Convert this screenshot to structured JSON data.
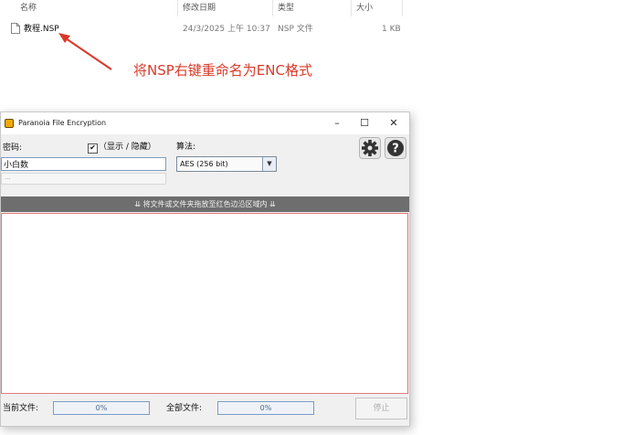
{
  "explorer": {
    "columns": {
      "name": "名称",
      "date": "修改日期",
      "type": "类型",
      "size": "大小"
    },
    "file": {
      "name": "教程.NSP",
      "date": "24/3/2025 上午 10:37",
      "type": "NSP 文件",
      "size": "1 KB"
    }
  },
  "annotation": {
    "text": "将NSP右键重命名为ENC格式",
    "color": "#d93a2a"
  },
  "app": {
    "title": "Paranoia File Encryption",
    "window_controls": {
      "minimize": "–",
      "maximize": "☐",
      "close": "✕"
    },
    "password_label": "密码:",
    "show_hide_label": "（显示 / 隐藏）",
    "show_hide_checked": "✔",
    "password_value": "小白数",
    "strength_text": "...",
    "algorithm_label": "算法:",
    "algorithm_value": "AES (256 bit)",
    "drop_banner": "⇊ 将文件或文件夹拖放至红色边沿区域内 ⇊",
    "current_file_label": "当前文件:",
    "current_progress": "0%",
    "all_files_label": "全部文件:",
    "all_progress": "0%",
    "stop_label": "停止",
    "accent": "#e07a7a"
  }
}
